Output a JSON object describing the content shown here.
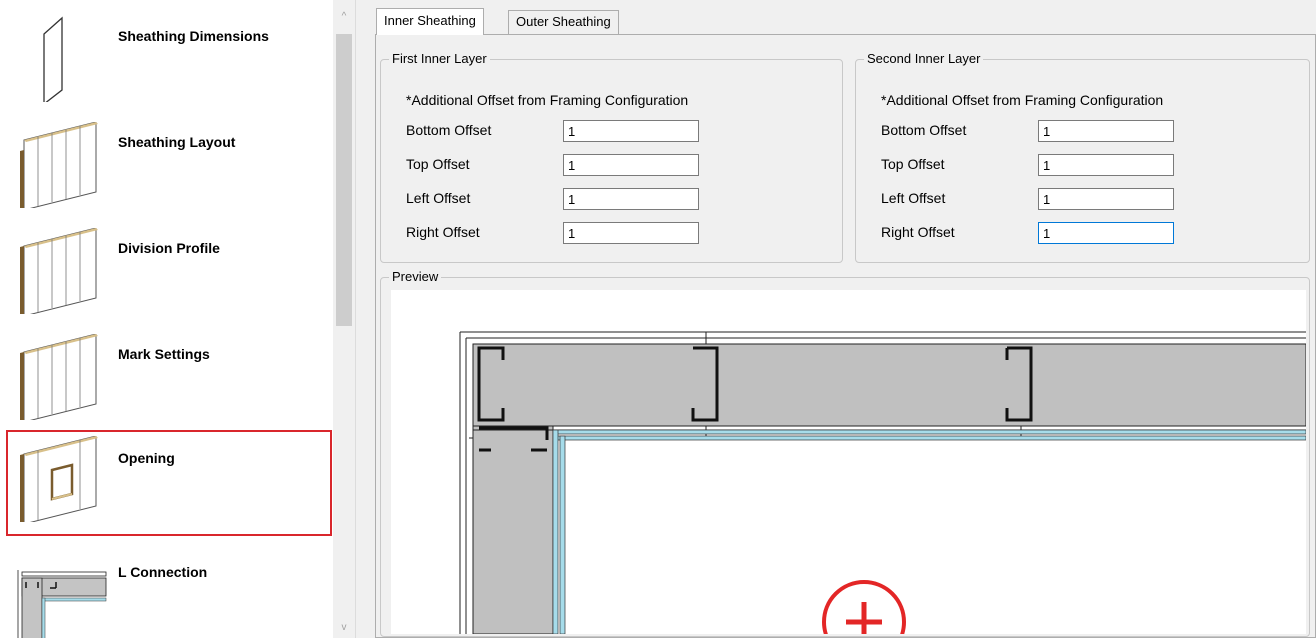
{
  "sidebar": {
    "items": [
      {
        "label": "Sheathing Dimensions",
        "icon": "sheathing-dimensions-icon"
      },
      {
        "label": "Sheathing Layout",
        "icon": "sheathing-layout-icon"
      },
      {
        "label": "Division Profile",
        "icon": "division-profile-icon"
      },
      {
        "label": "Mark Settings",
        "icon": "mark-settings-icon"
      },
      {
        "label": "Opening",
        "icon": "opening-icon",
        "selected": true
      },
      {
        "label": "L Connection",
        "icon": "l-connection-icon"
      }
    ],
    "scroll_up_glyph": "^",
    "scroll_down_glyph": "v"
  },
  "tabs": [
    {
      "label": "Inner Sheathing",
      "active": true
    },
    {
      "label": "Outer Sheathing",
      "active": false
    }
  ],
  "first_layer": {
    "title": "First Inner Layer",
    "note": "*Additional Offset from Framing Configuration",
    "fields": [
      {
        "label": "Bottom Offset",
        "value": "1"
      },
      {
        "label": "Top Offset",
        "value": "1"
      },
      {
        "label": "Left Offset",
        "value": "1"
      },
      {
        "label": "Right Offset",
        "value": "1"
      }
    ]
  },
  "second_layer": {
    "title": "Second Inner Layer",
    "note": "*Additional Offset from Framing Configuration",
    "fields": [
      {
        "label": "Bottom Offset",
        "value": "1"
      },
      {
        "label": "Top Offset",
        "value": "1"
      },
      {
        "label": "Left Offset",
        "value": "1"
      },
      {
        "label": "Right Offset",
        "value": "1",
        "focused": true
      }
    ]
  },
  "preview": {
    "title": "Preview"
  },
  "colors": {
    "selection_border": "#d9262c",
    "sheathing_fill": "#c0c0c0",
    "inner_layer": "#a6dcea",
    "origin_marker": "#e32626",
    "focus_border": "#0078d7"
  }
}
